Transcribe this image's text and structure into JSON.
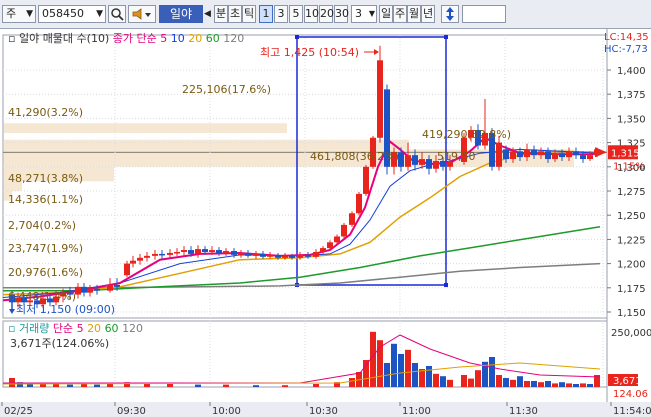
{
  "toolbar": {
    "market_select": "주",
    "code_input": "058450",
    "search_icon": "search-icon",
    "sound_icon": "speaker-icon",
    "stock_name": "일야",
    "prev_icon": "triangle-left-icon",
    "period_labels": [
      "분",
      "초",
      "틱"
    ],
    "interval_buttons": [
      "1",
      "3",
      "5",
      "10",
      "20",
      "30"
    ],
    "selected_interval": "1",
    "dropdown_value": "3",
    "period_buttons": [
      "일",
      "주",
      "월",
      "년"
    ],
    "updown_icon": "updown-arrows-icon"
  },
  "main_chart": {
    "legend_title": "일야 매물대 수(10)",
    "ma_label": "종가 단순",
    "ma_periods": [
      "5",
      "10",
      "20",
      "60",
      "120"
    ],
    "ma_colors": [
      "#e6007e",
      "#1440d8",
      "#e0a000",
      "#1c9a2c",
      "#7e7e7e"
    ],
    "lc_label": "LC:14,35",
    "hc_label": "HC:-7,73",
    "high_annotation": "최고 1,425 (10:54)",
    "low_annotation": "최저 1,150 (09:00)",
    "current_price": "1,315",
    "current_change": "1.15%",
    "y_ticks": [
      "1,400",
      "1,375",
      "1,350",
      "1,325",
      "1,300",
      "1,275",
      "1,250",
      "1,225",
      "1,200",
      "1,175",
      "1,150"
    ],
    "volume_profile_labels": [
      "225,106(17.6%)",
      "41,290(3.2%)",
      "419,290(32.8%)",
      "461,808(36.2%)",
      "519,50",
      "48,271(3.8%)",
      "14,336(1.1%)",
      "2,704(0.2%)",
      "23,747(1.9%)",
      "20,976(1.6%)",
      "6,448(1.4%)"
    ]
  },
  "volume_chart": {
    "legend_title": "거래량",
    "ma_label": "단순",
    "ma_periods": [
      "5",
      "20",
      "60",
      "120"
    ],
    "current_volume": "3,671주(124.06%)",
    "y_ticks": [
      "250,000"
    ],
    "right_value": "3,671",
    "right_ratio": "124.06"
  },
  "x_axis": {
    "labels": [
      "02/25",
      "09:30",
      "10:00",
      "10:30",
      "11:00",
      "11:30",
      "11:54:0"
    ]
  },
  "colors": {
    "up": "#e8241c",
    "down": "#1c54c4",
    "selection": "#1a2ad6",
    "profile": "#f5e6d0"
  }
}
